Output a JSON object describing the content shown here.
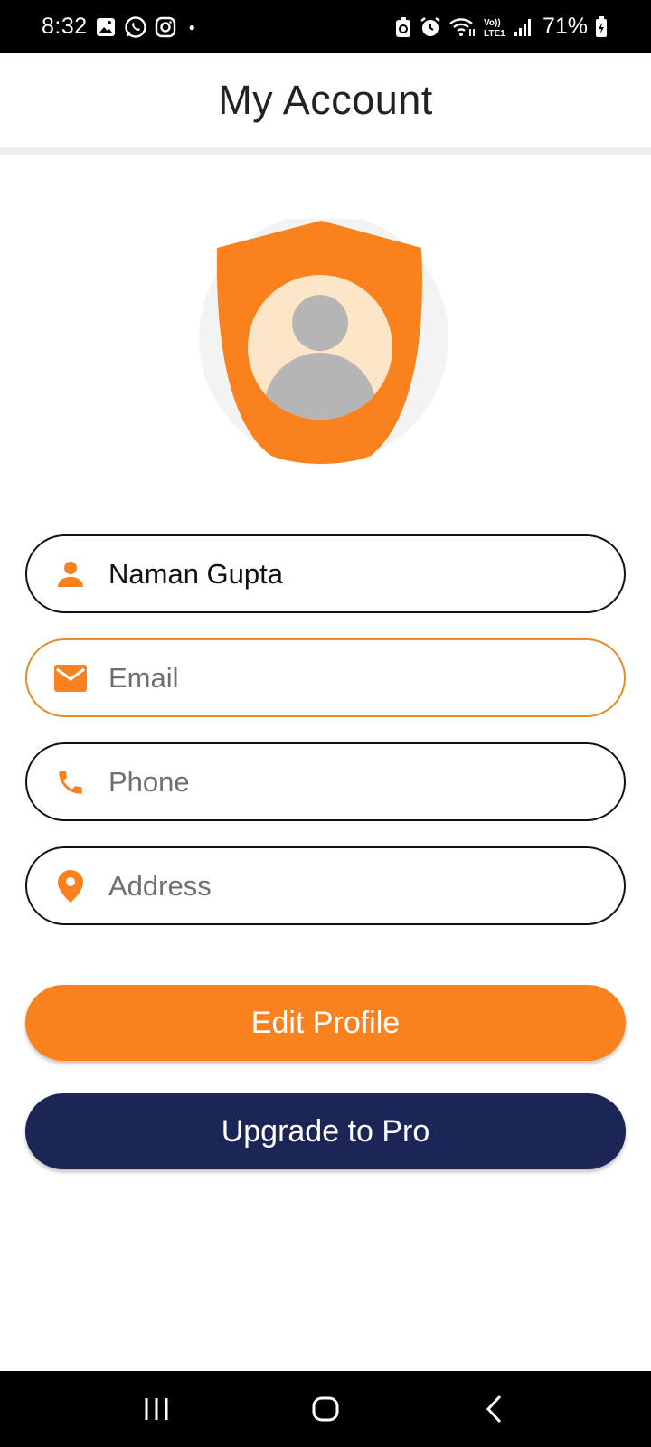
{
  "status_bar": {
    "time": "8:32",
    "battery": "71%",
    "left_icons": [
      "gallery-icon",
      "whatsapp-icon",
      "instagram-icon"
    ],
    "right_icons": [
      "data-saver-icon",
      "alarm-icon",
      "wifi-icon",
      "volte-icon",
      "signal-icon",
      "battery-charging-icon"
    ]
  },
  "header": {
    "title": "My Account"
  },
  "avatar": {
    "icon": "user-shield-avatar",
    "accent": "#F9821E"
  },
  "form": {
    "name": {
      "value": "Naman Gupta",
      "placeholder": "",
      "icon": "person-icon"
    },
    "email": {
      "value": "",
      "placeholder": "Email",
      "icon": "mail-icon",
      "focused": true
    },
    "phone": {
      "value": "",
      "placeholder": "Phone",
      "icon": "phone-icon"
    },
    "address": {
      "value": "",
      "placeholder": "Address",
      "icon": "location-pin-icon"
    }
  },
  "buttons": {
    "edit_profile": "Edit Profile",
    "upgrade": "Upgrade to Pro"
  },
  "nav_bar": {
    "items": [
      "recents-icon",
      "home-icon",
      "back-icon"
    ]
  },
  "colors": {
    "accent": "#F9821E",
    "navy": "#1B2556",
    "focus_border": "#E58B28"
  }
}
